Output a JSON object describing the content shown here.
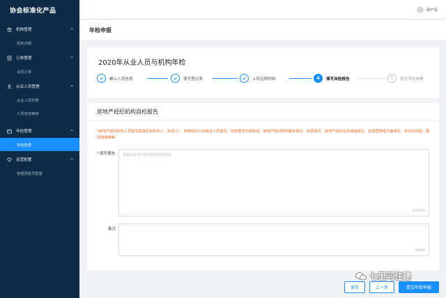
{
  "sidebar": {
    "brand": "协会标准化产品",
    "groups": [
      {
        "label": "机构管理",
        "icon": "bank-icon",
        "items": [
          "机构详情"
        ]
      },
      {
        "label": "订单管理",
        "icon": "order-icon",
        "items": [
          "会员订单"
        ]
      },
      {
        "label": "从业人员管理",
        "icon": "user-icon",
        "items": [
          "从业人员列表",
          "人员变动审核"
        ]
      },
      {
        "label": "年检管理",
        "icon": "calendar-icon",
        "items": [
          "年检信息"
        ]
      },
      {
        "label": "运营配置",
        "icon": "heart-icon",
        "items": [
          "管理员账号配置"
        ]
      }
    ],
    "active_item": "年检信息"
  },
  "topbar": {
    "username": "用户名"
  },
  "page": {
    "title": "年检申报"
  },
  "form": {
    "title": "2020年从业人员与机构年检",
    "steps": [
      {
        "label": "确认人员信息",
        "state": "done",
        "num": "1"
      },
      {
        "label": "填写登记表",
        "state": "done",
        "num": "2"
      },
      {
        "label": "上传证明材料",
        "state": "done",
        "num": "3"
      },
      {
        "label": "填写自检报告",
        "state": "current",
        "num": "4"
      },
      {
        "label": "提交年检申报",
        "state": "wait",
        "num": "5"
      }
    ]
  },
  "report": {
    "section_title": "房地产经纪机构自检报告",
    "notice": "*房地产经纪机构人员填写需填写机构法人（负责人）、持有经纪人资格证人员填写、自检报告内容包括：房地产经纪机构基本填写、收费情况、房地产经纪业务诚信情况、在经营管理方面填写、存在的问题、整改措施等等",
    "report_label": "填写报告",
    "report_required": "*",
    "report_placeholder": "请填写房地产经纪机构自检报告",
    "report_count": "0/1000",
    "remark_label": "备注",
    "remark_count": "0/500"
  },
  "actions": {
    "save": "保存",
    "prev": "上一步",
    "submit": "提交年检申报"
  },
  "watermark": {
    "text": "七里河住建"
  },
  "colors": {
    "primary": "#1890ff",
    "sidebar": "#0e2c47",
    "warning": "#f5691d"
  }
}
